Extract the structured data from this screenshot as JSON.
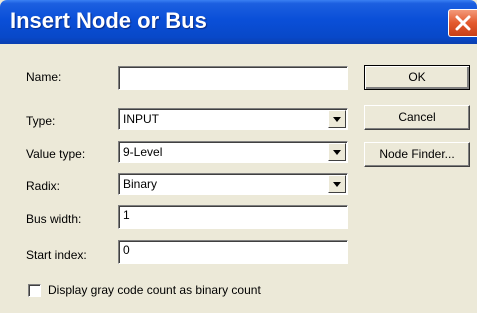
{
  "window": {
    "title": "Insert Node or Bus"
  },
  "form": {
    "name": {
      "label": "Name:",
      "value": ""
    },
    "type": {
      "label": "Type:",
      "value": "INPUT"
    },
    "value_type": {
      "label": "Value type:",
      "value": "9-Level"
    },
    "radix": {
      "label": "Radix:",
      "value": "Binary"
    },
    "bus_width": {
      "label": "Bus width:",
      "value": "1"
    },
    "start_index": {
      "label": "Start index:",
      "value": "0"
    },
    "gray_code": {
      "label": "Display gray code count as binary count",
      "checked": false
    }
  },
  "buttons": {
    "ok": "OK",
    "cancel": "Cancel",
    "node_finder": "Node Finder..."
  },
  "icons": {
    "close": "close-icon",
    "dropdown": "chevron-down-icon"
  },
  "colors": {
    "title_bar": "#0a4fd8",
    "dialog_bg": "#ece9d8",
    "close_button": "#e35a2e"
  }
}
